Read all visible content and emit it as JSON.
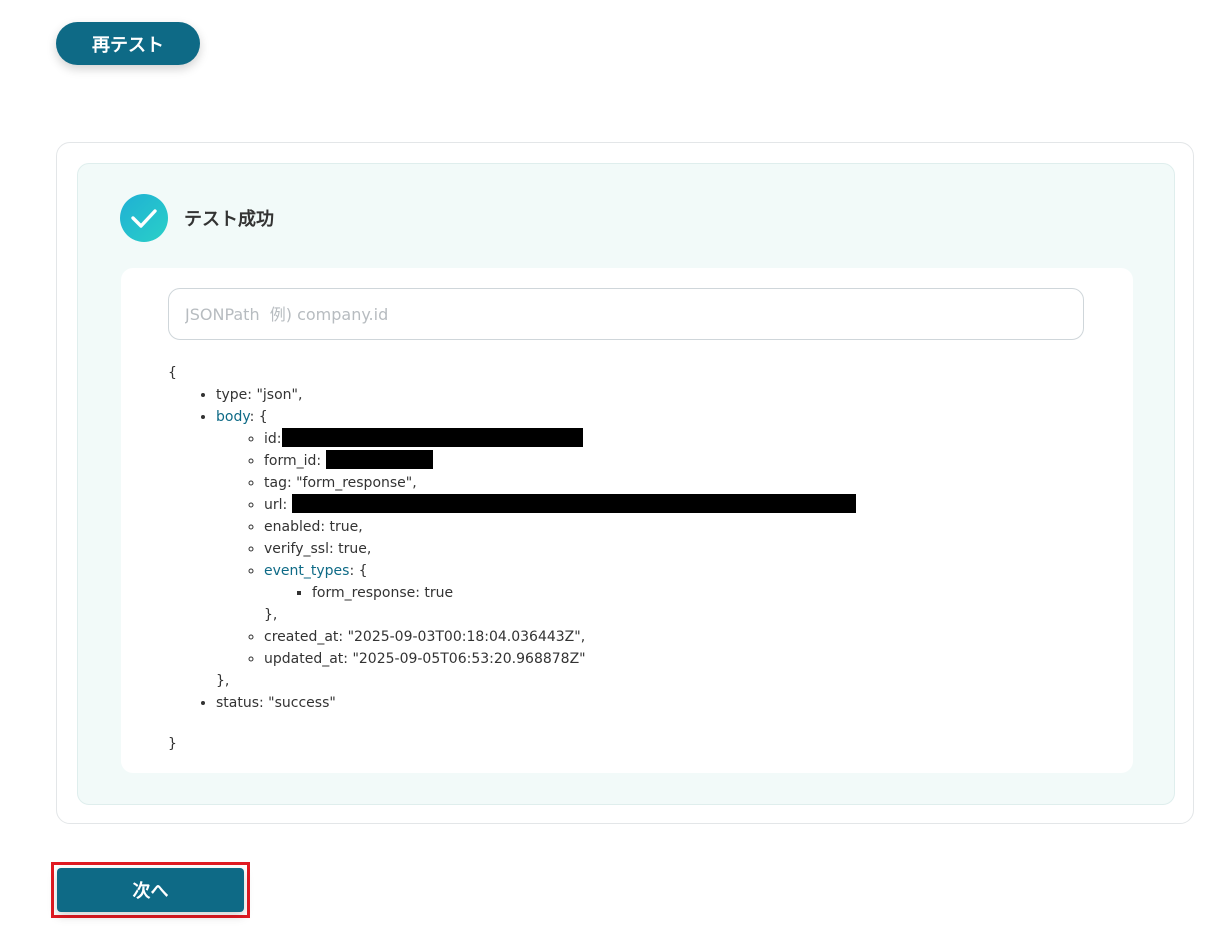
{
  "toolbar": {
    "retest_label": "再テスト"
  },
  "result": {
    "status_title": "テスト成功",
    "check_icon": "check-circle-icon",
    "check_gradient": [
      "#1fb0d4",
      "#2ad0c8"
    ]
  },
  "jsonpath": {
    "value": "",
    "placeholder": "JSONPath  例) company.id"
  },
  "json": {
    "open_brace": "{",
    "close_brace": "}",
    "type_line": "type: \"json\",",
    "body_key": "body",
    "body_open": ": {",
    "body_items": {
      "id_key": "id:",
      "form_id_key": "form_id:",
      "tag_line": "tag: \"form_response\",",
      "url_key": "url:",
      "enabled_line": "enabled: true,",
      "verify_ssl_line": "verify_ssl: true,",
      "event_types_key": "event_types",
      "event_types_open": ": {",
      "form_response_line": "form_response: true",
      "event_types_close": "},",
      "created_at_line": "created_at: \"2025-09-03T00:18:04.036443Z\",",
      "updated_at_line": "updated_at: \"2025-09-05T06:53:20.968878Z\""
    },
    "body_close": "},",
    "status_line": "status: \"success\""
  },
  "footer": {
    "next_label": "次へ"
  },
  "colors": {
    "primary": "#0e6a86",
    "highlight_border": "#e11a22",
    "panel_bg": "#f2faf9"
  }
}
